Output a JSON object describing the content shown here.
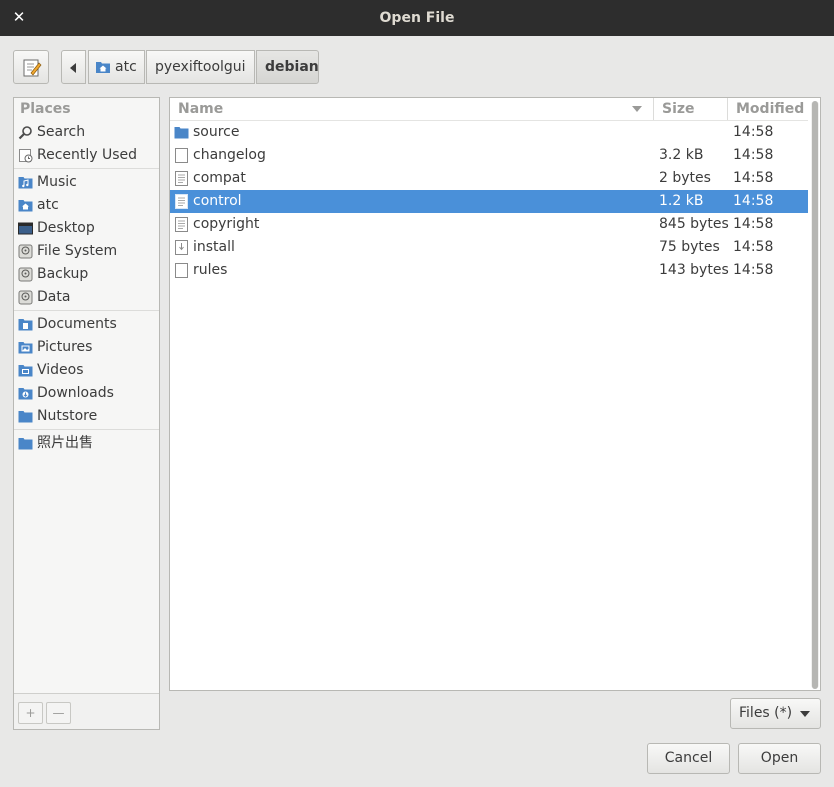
{
  "window": {
    "title": "Open File",
    "close_glyph": "✕"
  },
  "toolbar": {
    "edit_icon": "edit-location-icon",
    "back_icon": "back-arrow-icon"
  },
  "breadcrumb": [
    {
      "label": "atc",
      "icon": "home-folder-icon"
    },
    {
      "label": "pyexiftoolgui"
    },
    {
      "label": "debian",
      "current": true
    }
  ],
  "places": {
    "header": "Places",
    "items": [
      {
        "label": "Search",
        "icon": "search-icon"
      },
      {
        "label": "Recently Used",
        "icon": "clock-icon"
      },
      {
        "label": "Music",
        "icon": "music-folder-icon"
      },
      {
        "label": "atc",
        "icon": "home-folder-icon"
      },
      {
        "label": "Desktop",
        "icon": "desktop-icon"
      },
      {
        "label": "File System",
        "icon": "drive-icon"
      },
      {
        "label": "Backup",
        "icon": "drive-icon"
      },
      {
        "label": "Data",
        "icon": "drive-icon"
      },
      {
        "label": "Documents",
        "icon": "documents-folder-icon"
      },
      {
        "label": "Pictures",
        "icon": "pictures-folder-icon"
      },
      {
        "label": "Videos",
        "icon": "videos-folder-icon"
      },
      {
        "label": "Downloads",
        "icon": "downloads-folder-icon"
      },
      {
        "label": "Nutstore",
        "icon": "folder-icon"
      },
      {
        "label": "照片出售",
        "icon": "folder-icon"
      }
    ],
    "add_glyph": "+",
    "remove_glyph": "—"
  },
  "files": {
    "columns": {
      "name": "Name",
      "size": "Size",
      "modified": "Modified"
    },
    "rows": [
      {
        "name": "source",
        "size": "",
        "modified": "14:58",
        "icon": "folder-icon"
      },
      {
        "name": "changelog",
        "size": "3.2 kB",
        "modified": "14:58",
        "icon": "blank-file-icon"
      },
      {
        "name": "compat",
        "size": "2 bytes",
        "modified": "14:58",
        "icon": "text-file-icon"
      },
      {
        "name": "control",
        "size": "1.2 kB",
        "modified": "14:58",
        "icon": "text-file-icon",
        "selected": true
      },
      {
        "name": "copyright",
        "size": "845 bytes",
        "modified": "14:58",
        "icon": "text-file-icon"
      },
      {
        "name": "install",
        "size": "75 bytes",
        "modified": "14:58",
        "icon": "install-file-icon"
      },
      {
        "name": "rules",
        "size": "143 bytes",
        "modified": "14:58",
        "icon": "blank-file-icon"
      }
    ]
  },
  "filter": {
    "label": "Files (*)"
  },
  "actions": {
    "cancel": "Cancel",
    "open": "Open"
  },
  "colors": {
    "titlebar": "#2d2d2d",
    "selection": "#4a90d9",
    "folder": "#4a86c8"
  }
}
